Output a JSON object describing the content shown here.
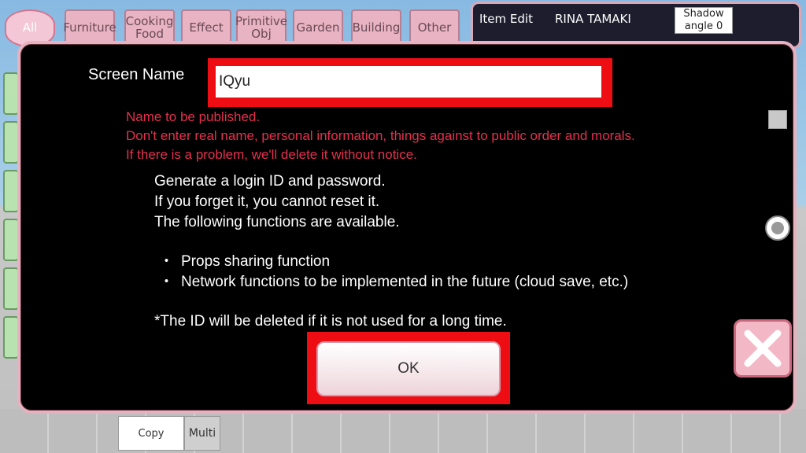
{
  "background": {
    "tabs": [
      "All",
      "Furniture",
      "Cooking Food",
      "Effect",
      "Primitive Obj",
      "Garden",
      "Building",
      "Other"
    ],
    "item_edit_label": "Item Edit",
    "character_name": "RINA TAMAKI",
    "shadow_label": "Shadow angle",
    "shadow_value": "0",
    "copy_button": "Copy",
    "multi_button": "Multi"
  },
  "dialog": {
    "screen_name_label": "Screen Name",
    "screen_name_value": "IQyu",
    "warning_lines": [
      "Name to be published.",
      "Don't enter real name, personal information, things against to public order and morals.",
      "If there is a problem, we'll delete it without notice."
    ],
    "info_lines": [
      "Generate a login ID and password.",
      "If you forget it, you cannot reset it.",
      "The following functions are available."
    ],
    "bullet_items": [
      "Props sharing function",
      "Network functions to be implemented in the future (cloud save, etc.)"
    ],
    "footnote": "*The ID will be deleted if it is not used for a long time.",
    "ok_label": "OK"
  },
  "colors": {
    "highlight_frame": "#ef0d14",
    "warning_text": "#e5304f",
    "dialog_border": "#e7b2bf"
  }
}
